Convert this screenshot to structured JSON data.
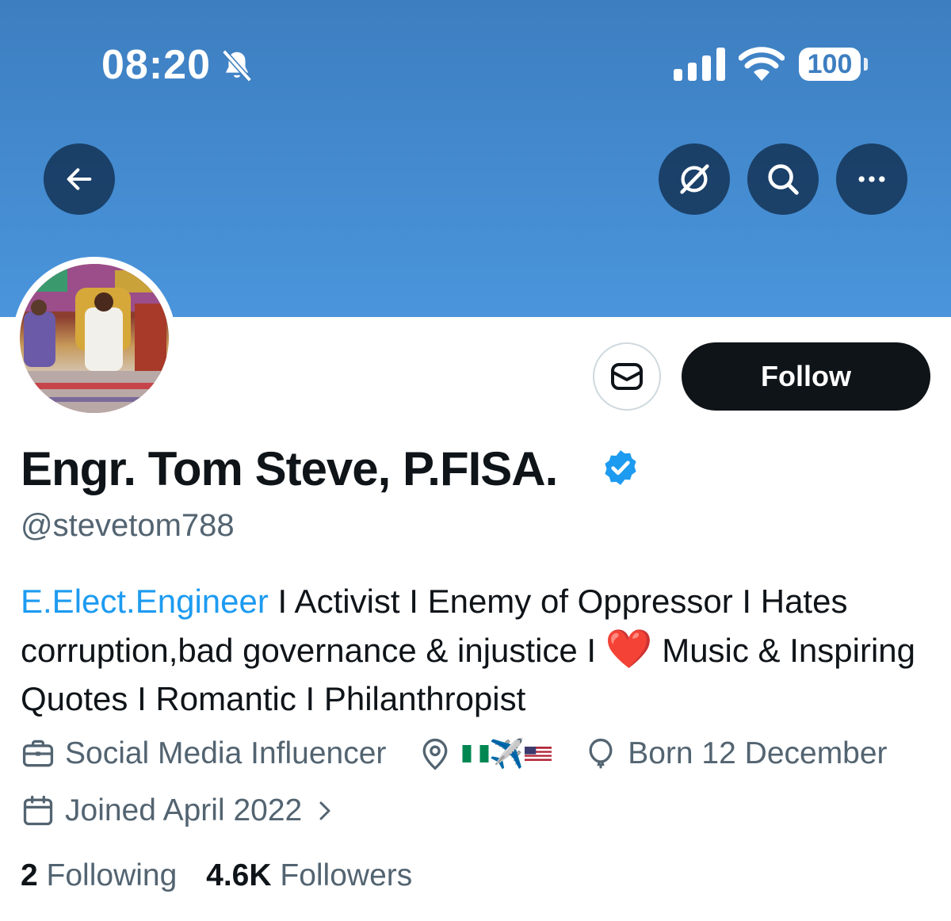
{
  "status_bar": {
    "time": "08:20",
    "battery": "100"
  },
  "header_buttons": {
    "back": "back-arrow-icon",
    "grok": "grok-icon",
    "search": "search-icon",
    "more": "more-icon"
  },
  "profile": {
    "display_name": "Engr. Tom Steve, P.FISA.",
    "handle": "@stevetom788",
    "verified": true,
    "follow_label": "Follow",
    "bio": {
      "link_text": "E.Elect.Engineer",
      "part1": " I Activist I Enemy of Oppressor I Hates corruption,bad governance & injustice I ",
      "heart": "❤️",
      "part2": " Music & Inspiring Quotes I Romantic I Philanthropist"
    },
    "category": "Social Media Influencer",
    "location_emoji": "✈️",
    "birthday": "Born 12 December",
    "joined": "Joined April 2022",
    "following_count": "2",
    "following_label": "Following",
    "followers_count": "4.6K",
    "followers_label": "Followers"
  },
  "colors": {
    "banner_top": "#3d7ec0",
    "banner_bottom": "#4a95dc",
    "link": "#1d9bf0",
    "verified": "#1d9bf0",
    "text_primary": "#0f1419",
    "text_secondary": "#536471"
  }
}
